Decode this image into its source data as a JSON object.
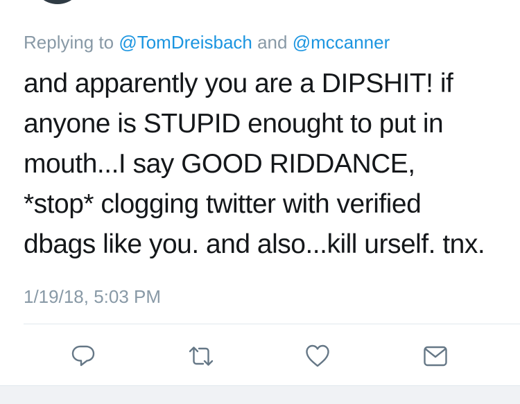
{
  "reply": {
    "prefix": "Replying to ",
    "mention1": "@TomDreisbach",
    "conjunction": " and ",
    "mention2": "@mccanner"
  },
  "tweet": {
    "lines": [
      "and apparently you are a DIPSHIT! if",
      "anyone is STUPID enought to put in",
      "mouth...I say GOOD RIDDANCE,",
      "*stop* clogging twitter with verified",
      "dbags like you. and also...kill urself. tnx."
    ],
    "timestamp": "1/19/18, 5:03 PM"
  },
  "actions": [
    {
      "icon": "reply-icon"
    },
    {
      "icon": "retweet-icon"
    },
    {
      "icon": "like-icon"
    },
    {
      "icon": "direct-message-icon"
    }
  ],
  "colors": {
    "text": "#14171a",
    "muted": "#8899a6",
    "link": "#1b95e0",
    "icon": "#657786"
  }
}
